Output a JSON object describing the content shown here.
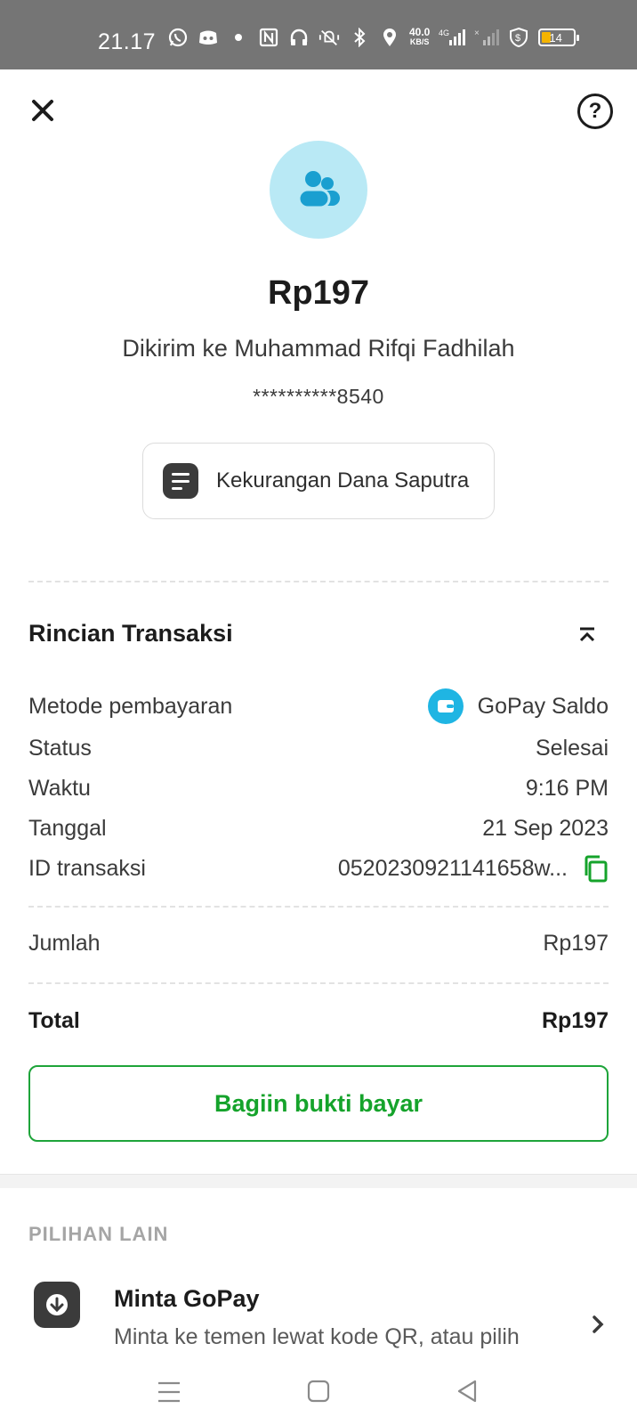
{
  "status_bar": {
    "time": "21.17",
    "network_speed": "40.0",
    "network_unit": "KB/S",
    "network_type": "4G",
    "battery_level": "14",
    "icons": [
      "whatsapp-icon",
      "discord-icon",
      "dot-icon",
      "nfc-icon",
      "headphones-icon",
      "mute-vibrate-icon",
      "bluetooth-icon",
      "location-icon",
      "signal-icon",
      "signal-no-sim-icon",
      "shield-icon",
      "battery-icon"
    ]
  },
  "header": {
    "close_icon": "close-icon",
    "help_icon": "help-icon",
    "help_label": "?"
  },
  "transaction": {
    "avatar_icon": "users-icon",
    "amount": "Rp197",
    "recipient": "Dikirim ke Muhammad Rifqi Fadhilah",
    "account_masked": "**********8540",
    "note": "Kekurangan Dana Saputra"
  },
  "details": {
    "title": "Rincian Transaksi",
    "rows": [
      {
        "label": "Metode pembayaran",
        "value": "GoPay Saldo"
      },
      {
        "label": "Status",
        "value": "Selesai"
      },
      {
        "label": "Waktu",
        "value": "9:16 PM"
      },
      {
        "label": "Tanggal",
        "value": "21 Sep 2023"
      },
      {
        "label": "ID transaksi",
        "value": "0520230921141658w..."
      }
    ],
    "amount_label": "Jumlah",
    "amount_value": "Rp197",
    "total_label": "Total",
    "total_value": "Rp197"
  },
  "share_button": "Bagiin bukti bayar",
  "other_options": {
    "title": "PILIHAN LAIN",
    "items": [
      {
        "title": "Minta GoPay",
        "subtitle": "Minta ke temen lewat kode QR, atau pilih",
        "icon": "download-arrow-icon"
      }
    ]
  },
  "colors": {
    "status_bar": "#757575",
    "accent_green": "#15a32b",
    "avatar_bg": "#b9e9f5",
    "gopay_blue": "#1fb5e3"
  }
}
